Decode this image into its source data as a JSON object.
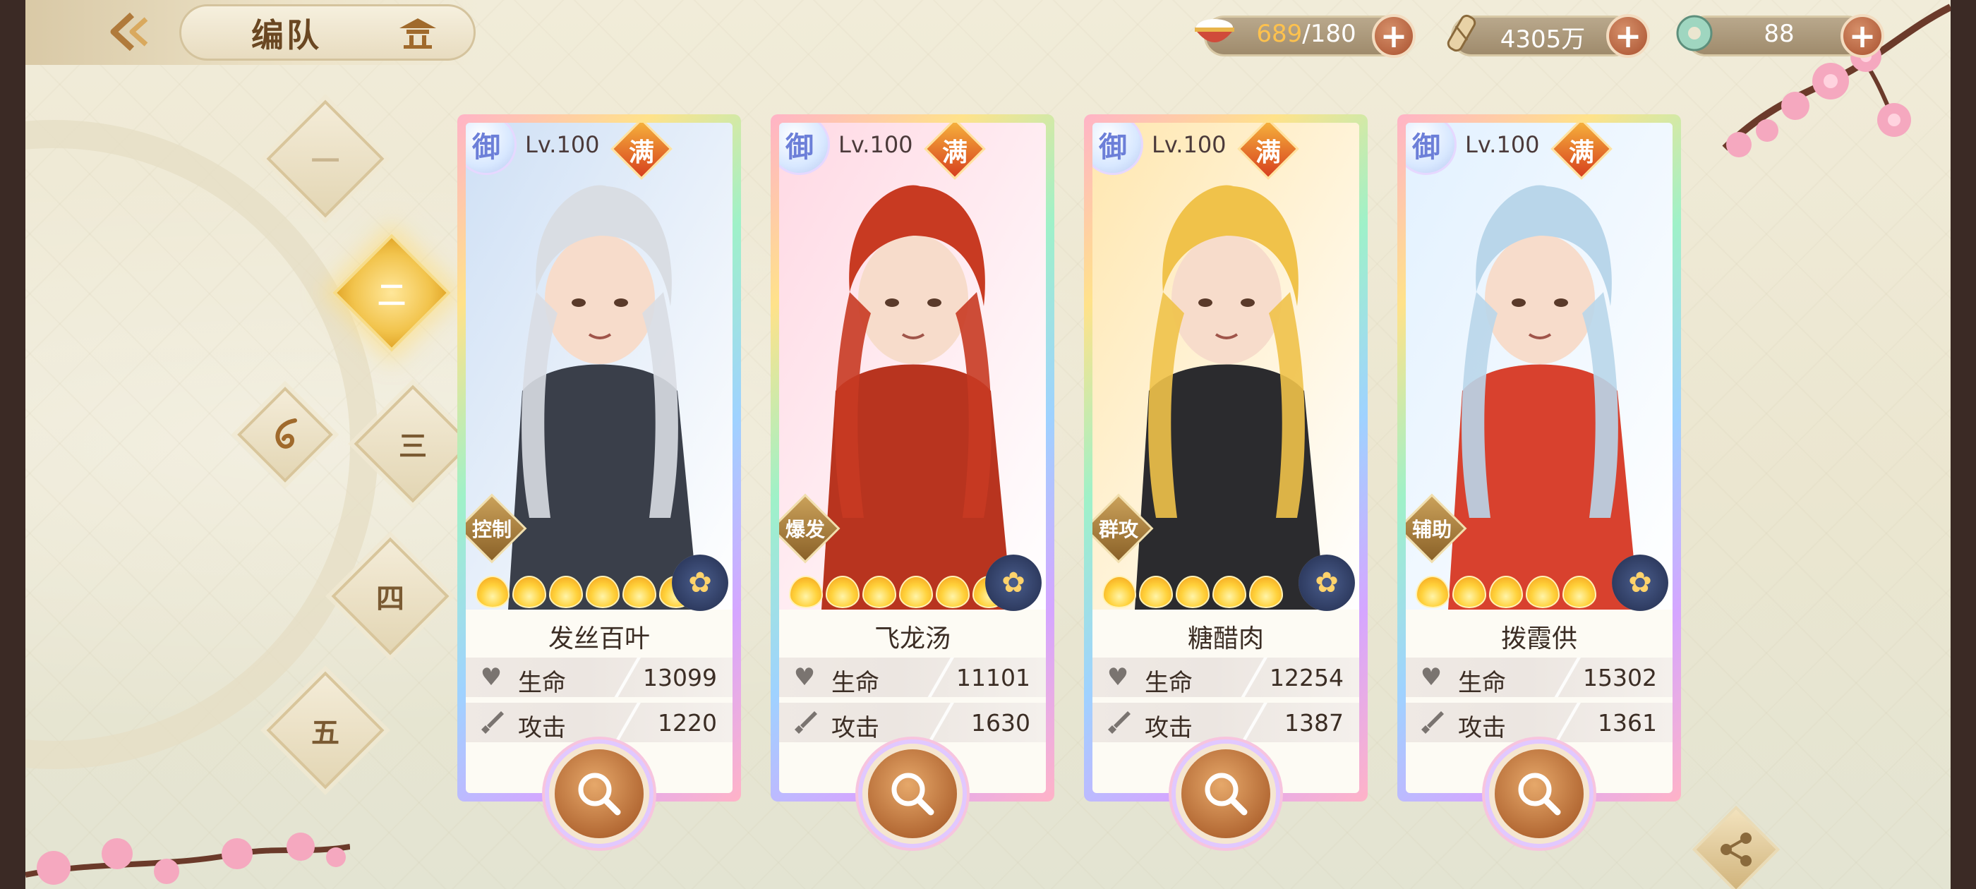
{
  "header": {
    "title": "编队",
    "back_icon": "back-arrow-icon",
    "pavilion_icon": "pavilion-icon"
  },
  "resources": [
    {
      "icon": "rice-bowl-icon",
      "current": "689",
      "max": "/180"
    },
    {
      "icon": "coin-icon",
      "value": "4305万"
    },
    {
      "icon": "jade-icon",
      "value": "88"
    }
  ],
  "formation_tabs": [
    {
      "label": "一",
      "state": "normal"
    },
    {
      "label": "二",
      "state": "active"
    },
    {
      "label": "三",
      "state": "normal"
    },
    {
      "label": "四",
      "state": "normal"
    },
    {
      "label": "五",
      "state": "normal"
    }
  ],
  "special_tab": {
    "icon": "swirl-icon"
  },
  "cards": [
    {
      "badge": "御",
      "level": "Lv.100",
      "max_badge": "满",
      "role": "控制",
      "stars": 6,
      "element": "flower-gold-icon",
      "name": "发丝百叶",
      "hp_label": "生命",
      "hp": "13099",
      "atk_label": "攻击",
      "atk": "1220",
      "hair": "#d9dde3",
      "outfit": "#3a3f4a",
      "bg": "#cfe0f5"
    },
    {
      "badge": "御",
      "level": "Lv.100",
      "max_badge": "满",
      "role": "爆发",
      "stars": 6,
      "element": "flower-blue-icon",
      "name": "飞龙汤",
      "hp_label": "生命",
      "hp": "11101",
      "atk_label": "攻击",
      "atk": "1630",
      "hair": "#c83a22",
      "outfit": "#b8341f",
      "bg": "#ffd9e4"
    },
    {
      "badge": "御",
      "level": "Lv.100",
      "max_badge": "满",
      "role": "群攻",
      "stars": 5,
      "element": "flower-blue-icon",
      "name": "糖醋肉",
      "hp_label": "生命",
      "hp": "12254",
      "atk_label": "攻击",
      "atk": "1387",
      "hair": "#f0c24a",
      "outfit": "#2b2b2e",
      "bg": "#ffe7b0"
    },
    {
      "badge": "御",
      "level": "Lv.100",
      "max_badge": "满",
      "role": "辅助",
      "stars": 5,
      "element": "flower-blue-icon",
      "name": "拨霞供",
      "hp_label": "生命",
      "hp": "15302",
      "atk_label": "攻击",
      "atk": "1361",
      "hair": "#b9d6ea",
      "outfit": "#d8412e",
      "bg": "#e2f1ff"
    }
  ],
  "colors": {
    "accent_gold": "#f2c44d",
    "button_brown": "#b46a35",
    "text_dark": "#3b2d24"
  }
}
